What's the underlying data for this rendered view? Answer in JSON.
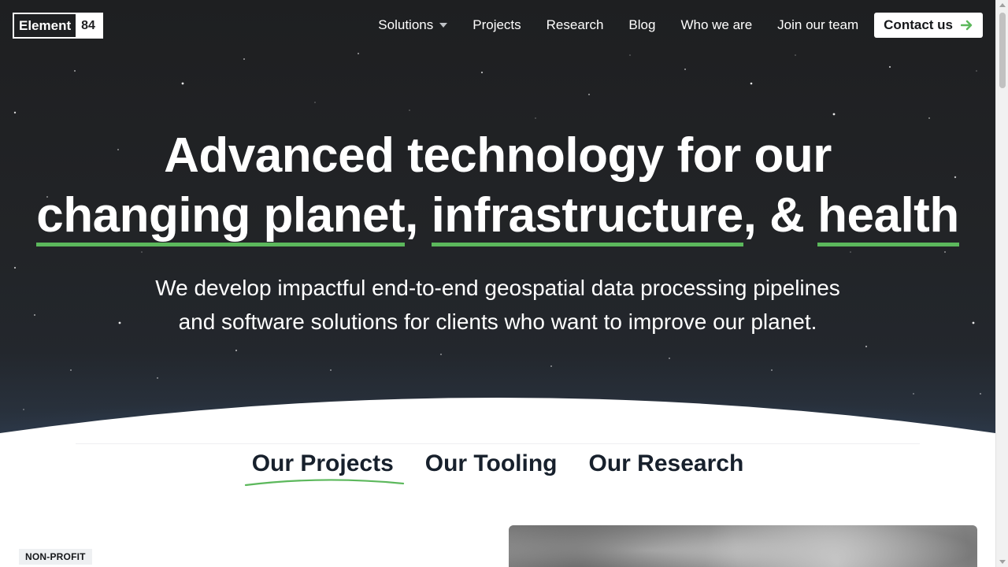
{
  "brand": {
    "logo_word": "Element",
    "logo_number": "84"
  },
  "nav": {
    "items": [
      {
        "label": "Solutions",
        "has_dropdown": true
      },
      {
        "label": "Projects"
      },
      {
        "label": "Research"
      },
      {
        "label": "Blog"
      },
      {
        "label": "Who we are"
      },
      {
        "label": "Join our team"
      }
    ],
    "cta_label": "Contact us",
    "cta_icon": "arrow-right-icon"
  },
  "hero": {
    "line1": "Advanced technology for our",
    "highlight1": "changing planet",
    "sep1": ", ",
    "highlight2": "infrastructure",
    "sep2": ", & ",
    "highlight3": "health",
    "sub_line1": "We develop impactful end-to-end geospatial data processing pipelines",
    "sub_line2": "and software solutions for clients who want to improve our planet."
  },
  "tabs": {
    "items": [
      {
        "label": "Our Projects",
        "active": true
      },
      {
        "label": "Our Tooling",
        "active": false
      },
      {
        "label": "Our Research",
        "active": false
      }
    ]
  },
  "project": {
    "badge": "NON-PROFIT"
  },
  "colors": {
    "accent": "#5cb85c",
    "hero_bg": "#1e1f21",
    "heading_dark": "#17202c"
  }
}
